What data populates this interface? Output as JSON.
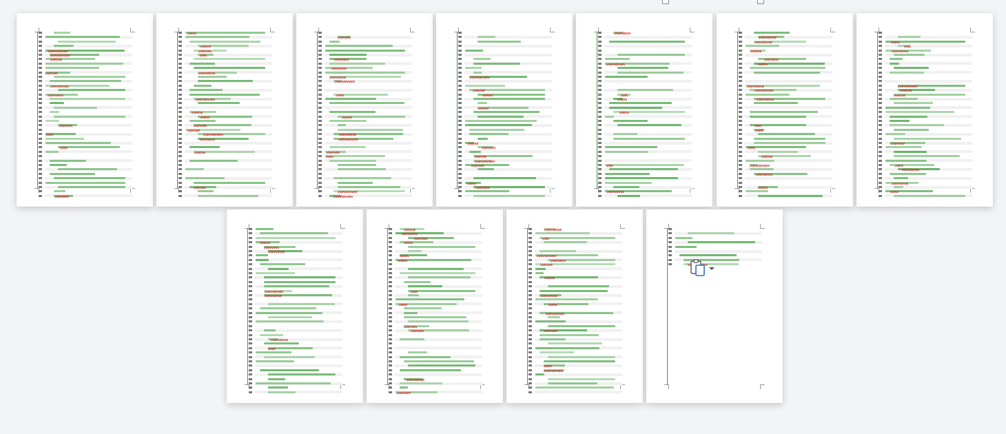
{
  "document": {
    "page_count": 11,
    "pages": [
      {
        "number": 1,
        "first_line": 1,
        "last_line": 38
      },
      {
        "number": 2,
        "first_line": 39,
        "last_line": 76
      },
      {
        "number": 3,
        "first_line": 77,
        "last_line": 114
      },
      {
        "number": 4,
        "first_line": 115,
        "last_line": 152
      },
      {
        "number": 5,
        "first_line": 153,
        "last_line": 190
      },
      {
        "number": 6,
        "first_line": 191,
        "last_line": 228
      },
      {
        "number": 7,
        "first_line": 229,
        "last_line": 266
      },
      {
        "number": 8,
        "first_line": 267,
        "last_line": 304
      },
      {
        "number": 9,
        "first_line": 305,
        "last_line": 342
      },
      {
        "number": 10,
        "first_line": 343,
        "last_line": 380
      },
      {
        "number": 11,
        "first_line": 381,
        "last_line": 389
      }
    ]
  },
  "colors": {
    "code_text": "#2e9a2e",
    "line_number": "#4a4a4a",
    "spelling_error": "#d23030",
    "gutter": "#3c9a3c",
    "page": "#ffffff",
    "background": "#f3f4f6"
  },
  "paste_options": {
    "icon": "clipboard-paste-icon",
    "dropdown_icon": "chevron-down-icon"
  }
}
